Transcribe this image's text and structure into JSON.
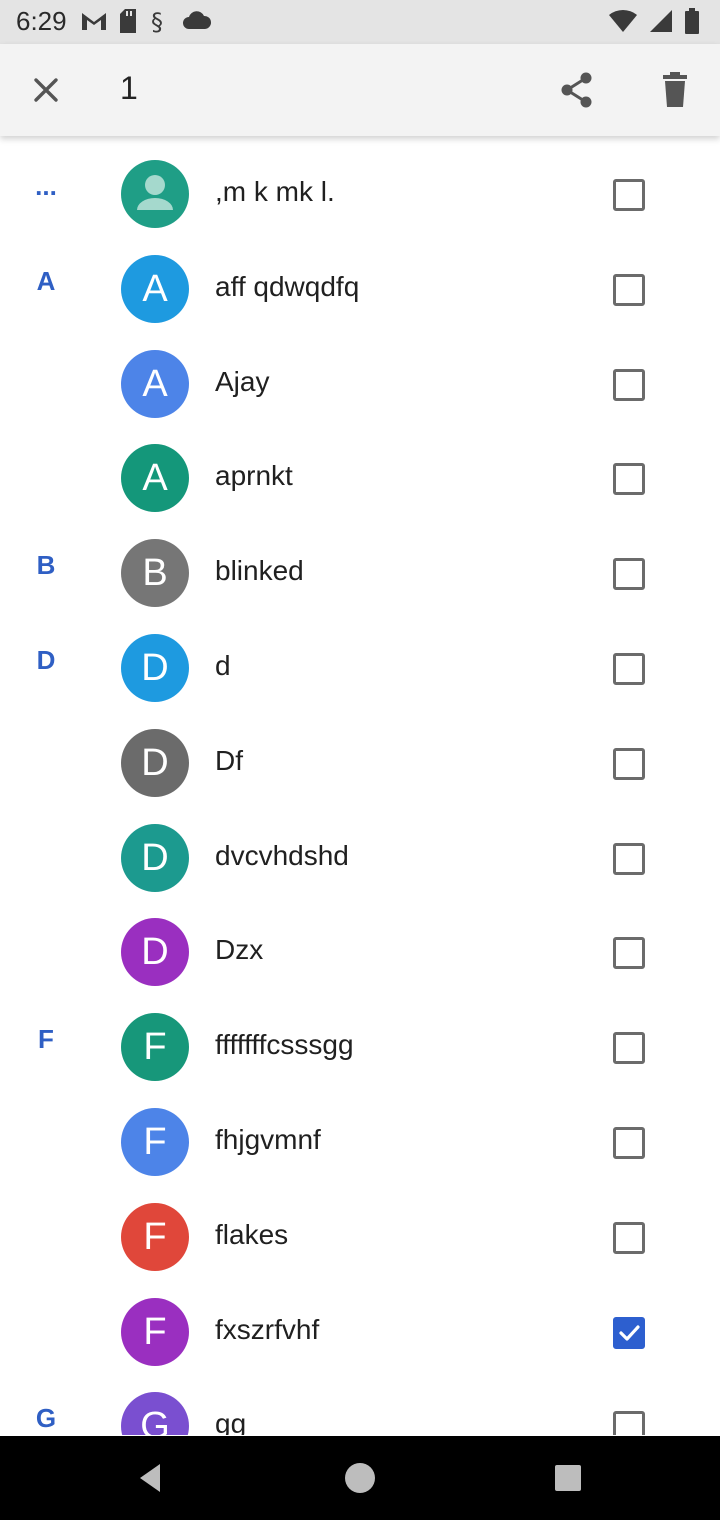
{
  "status_bar": {
    "time": "6:29",
    "left_icons": [
      "gmail-icon",
      "sd-card-icon",
      "sync-icon",
      "cloud-icon"
    ],
    "right_icons": [
      "wifi-icon",
      "signal-icon",
      "battery-icon"
    ]
  },
  "app_bar": {
    "selected_count": "1",
    "close_icon": "close-icon",
    "share_icon": "share-icon",
    "delete_icon": "trash-icon"
  },
  "contacts": [
    {
      "section": "...",
      "name": ",m k mk l.",
      "initial": "",
      "avatar_color": "#1f9e86",
      "checked": false,
      "generic": true
    },
    {
      "section": "A",
      "name": "aff qdwqdfq",
      "initial": "A",
      "avatar_color": "#1e9ae0",
      "checked": false
    },
    {
      "section": "",
      "name": "Ajay",
      "initial": "A",
      "avatar_color": "#4d84e8",
      "checked": false
    },
    {
      "section": "",
      "name": "aprnkt",
      "initial": "A",
      "avatar_color": "#14977a",
      "checked": false
    },
    {
      "section": "B",
      "name": "blinked",
      "initial": "B",
      "avatar_color": "#767676",
      "checked": false
    },
    {
      "section": "D",
      "name": "d",
      "initial": "D",
      "avatar_color": "#1e9ae0",
      "checked": false
    },
    {
      "section": "",
      "name": "Df",
      "initial": "D",
      "avatar_color": "#6b6b6b",
      "checked": false
    },
    {
      "section": "",
      "name": "dvcvhdshd",
      "initial": "D",
      "avatar_color": "#1c9a8f",
      "checked": false
    },
    {
      "section": "",
      "name": "Dzx",
      "initial": "D",
      "avatar_color": "#9a2fc0",
      "checked": false
    },
    {
      "section": "F",
      "name": "fffffffcsssgg",
      "initial": "F",
      "avatar_color": "#17977a",
      "checked": false
    },
    {
      "section": "",
      "name": "fhjgvmnf",
      "initial": "F",
      "avatar_color": "#4d84e8",
      "checked": false
    },
    {
      "section": "",
      "name": "flakes",
      "initial": "F",
      "avatar_color": "#e0473a",
      "checked": false
    },
    {
      "section": "",
      "name": "fxszrfvhf",
      "initial": "F",
      "avatar_color": "#9a2fc0",
      "checked": true
    },
    {
      "section": "G",
      "name": "gg",
      "initial": "G",
      "avatar_color": "#7a4fd0",
      "checked": false
    }
  ],
  "colors": {
    "accent": "#2d5fcf",
    "section_letter": "#2f5fc4",
    "app_bar_bg": "#f3f3f3",
    "status_bar_bg": "#e4e4e4"
  },
  "nav_bar": {
    "back_icon": "back-triangle-icon",
    "home_icon": "home-circle-icon",
    "recents_icon": "recents-square-icon"
  }
}
